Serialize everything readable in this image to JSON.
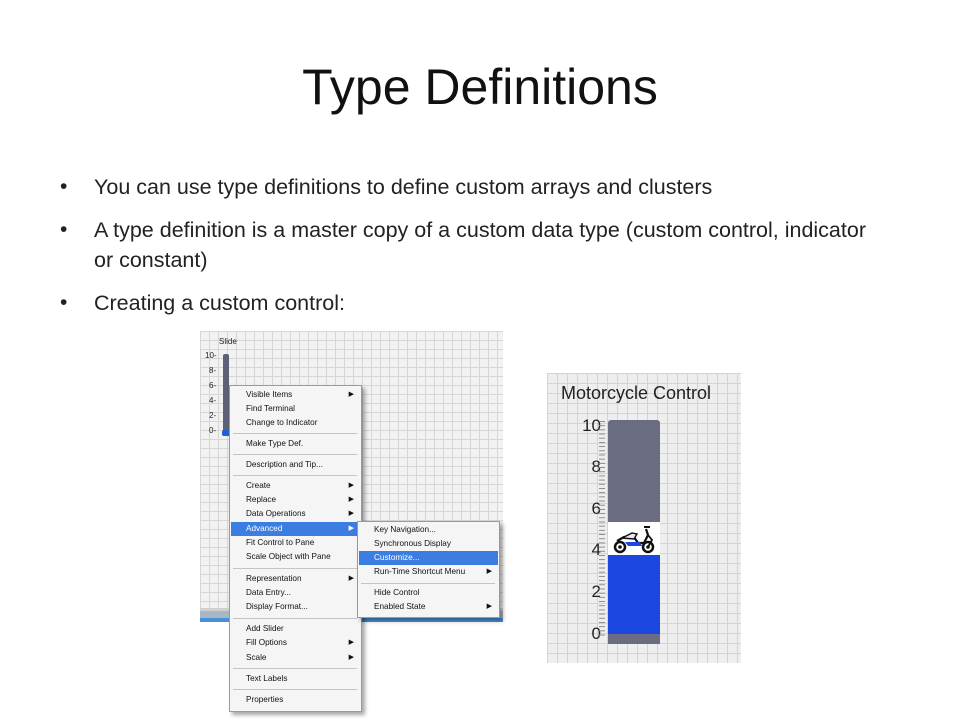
{
  "slide": {
    "title": "Type Definitions",
    "bullets": [
      "You can use type definitions to define custom arrays and clusters",
      "A type definition is a master copy of a custom data type (custom control, indicator or constant)",
      "Creating a custom control:"
    ]
  },
  "front_panel": {
    "slide_label": "Slide",
    "ticks": [
      "10-",
      "8-",
      "6-",
      "4-",
      "2-",
      "0-"
    ]
  },
  "context_menu": {
    "items": [
      {
        "label": "Visible Items",
        "submenu": true
      },
      {
        "label": "Find Terminal",
        "submenu": false
      },
      {
        "label": "Change to Indicator",
        "submenu": false
      },
      {
        "label": "Make Type Def.",
        "submenu": false
      },
      {
        "label": "Description and Tip...",
        "submenu": false
      },
      {
        "label": "Create",
        "submenu": true
      },
      {
        "label": "Replace",
        "submenu": true
      },
      {
        "label": "Data Operations",
        "submenu": true
      },
      {
        "label": "Advanced",
        "submenu": true,
        "highlighted": true
      },
      {
        "label": "Fit Control to Pane",
        "submenu": false
      },
      {
        "label": "Scale Object with Pane",
        "submenu": false
      },
      {
        "label": "Representation",
        "submenu": true
      },
      {
        "label": "Data Entry...",
        "submenu": false
      },
      {
        "label": "Display Format...",
        "submenu": false
      },
      {
        "label": "Add Slider",
        "submenu": false
      },
      {
        "label": "Fill Options",
        "submenu": true
      },
      {
        "label": "Scale",
        "submenu": true
      },
      {
        "label": "Text Labels",
        "submenu": false
      },
      {
        "label": "Properties",
        "submenu": false
      }
    ],
    "arrow": "▶"
  },
  "advanced_submenu": {
    "items": [
      {
        "label": "Key Navigation...",
        "submenu": false
      },
      {
        "label": "Synchronous Display",
        "submenu": false
      },
      {
        "label": "Customize...",
        "submenu": false,
        "highlighted": true
      },
      {
        "label": "Run-Time Shortcut Menu",
        "submenu": true
      },
      {
        "label": "Hide Control",
        "submenu": false
      },
      {
        "label": "Enabled State",
        "submenu": true
      }
    ]
  },
  "motorcycle_control": {
    "title": "Motorcycle Control",
    "ticks": [
      "10",
      "8",
      "6",
      "4",
      "2",
      "0"
    ],
    "value": 4,
    "range": [
      0,
      10
    ],
    "colors": {
      "track": "#6a6d82",
      "fill": "#1b46e0"
    }
  }
}
